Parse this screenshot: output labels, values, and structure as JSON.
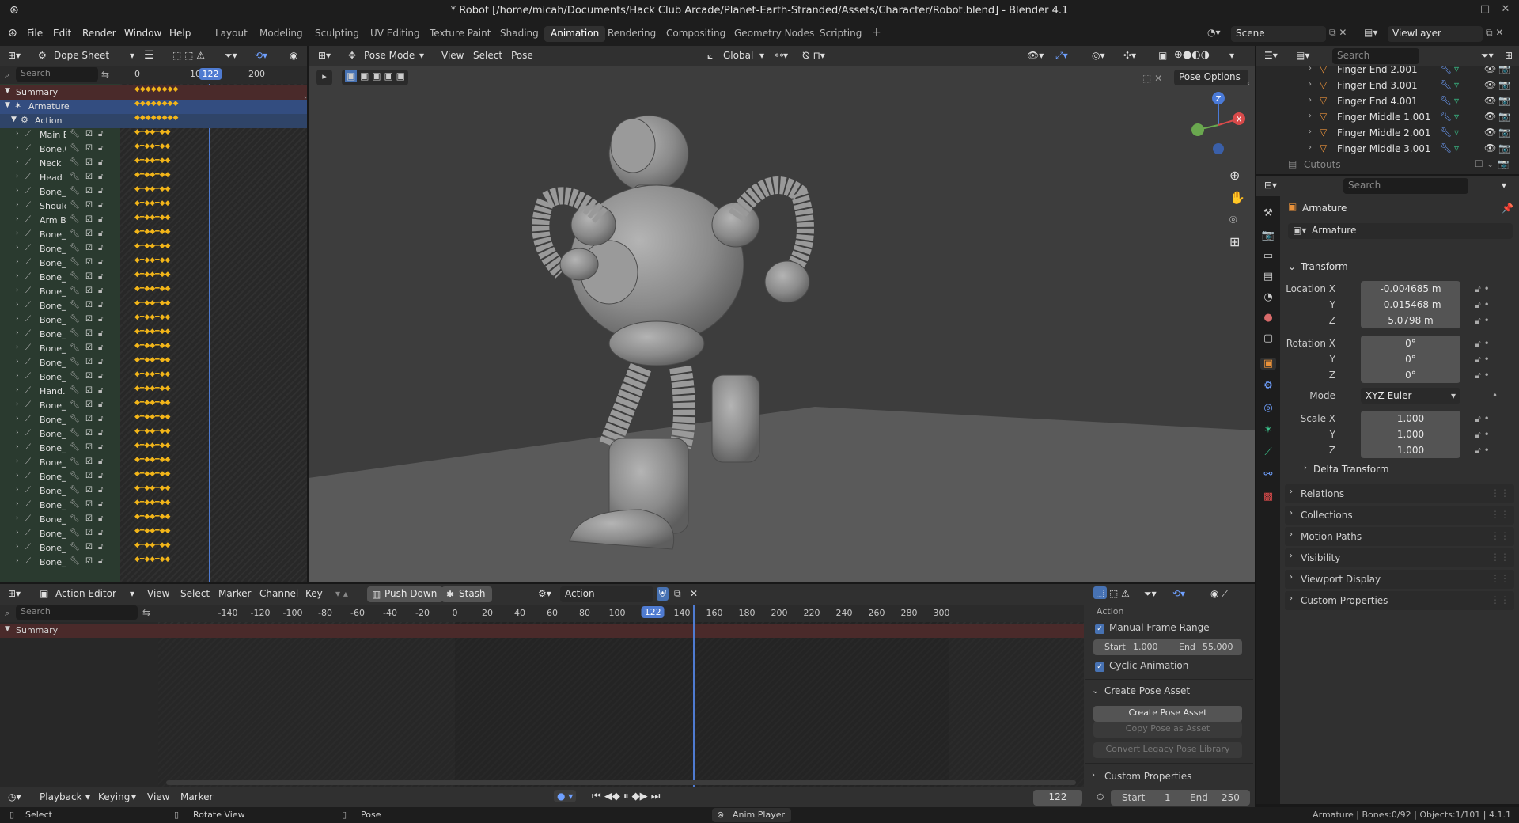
{
  "window": {
    "title": "* Robot [/home/micah/Documents/Hack Club Arcade/Planet-Earth-Stranded/Assets/Character/Robot.blend] - Blender 4.1"
  },
  "menu": [
    "File",
    "Edit",
    "Render",
    "Window",
    "Help"
  ],
  "workspaces": [
    "Layout",
    "Modeling",
    "Sculpting",
    "UV Editing",
    "Texture Paint",
    "Shading",
    "Animation",
    "Rendering",
    "Compositing",
    "Geometry Nodes",
    "Scripting"
  ],
  "active_workspace": "Animation",
  "scene": "Scene",
  "view_layer": "ViewLayer",
  "dopesheet": {
    "mode": "Dope Sheet",
    "search_placeholder": "Search",
    "current_frame": "122",
    "ticks": [
      "0",
      "10",
      "200"
    ],
    "summary": "Summary",
    "armature": "Armature",
    "action": "Action",
    "channels": [
      "Main B",
      "Bone.0",
      "Neck",
      "Head",
      "Bone_l",
      "Should",
      "Arm Ba",
      "Bone_l",
      "Bone_l",
      "Bone_l",
      "Bone_l",
      "Bone_l",
      "Bone_l",
      "Bone_l",
      "Bone_l",
      "Bone_l",
      "Bone_l",
      "Bone_l",
      "Hand.L",
      "Bone_l",
      "Bone_l",
      "Bone_l",
      "Bone_l",
      "Bone_l",
      "Bone_l",
      "Bone_l",
      "Bone_l",
      "Bone_l",
      "Bone_l",
      "Bone_l",
      "Bone_F"
    ]
  },
  "viewport": {
    "mode": "Pose Mode",
    "menus": [
      "View",
      "Select",
      "Pose"
    ],
    "transform_orientation": "Global",
    "pose_options": "Pose Options",
    "gizmo": {
      "z": "Z",
      "x": "X"
    }
  },
  "outliner": {
    "search_placeholder": "Search",
    "items": [
      "Finger End 2.001",
      "Finger End 3.001",
      "Finger End 4.001",
      "Finger Middle 1.001",
      "Finger Middle 2.001",
      "Finger Middle 3.001"
    ],
    "collection": "Cutouts"
  },
  "properties": {
    "search_placeholder": "Search",
    "object_name": "Armature",
    "datablock": "Armature",
    "transform_label": "Transform",
    "location_label": "Location X",
    "location": [
      "-0.004685 m",
      "-0.015468 m",
      "5.0798 m"
    ],
    "rotation_label": "Rotation X",
    "rotation": [
      "0°",
      "0°",
      "0°"
    ],
    "mode_label": "Mode",
    "mode": "XYZ Euler",
    "scale_label": "Scale X",
    "scale": [
      "1.000",
      "1.000",
      "1.000"
    ],
    "axis_y": "Y",
    "axis_z": "Z",
    "sections": [
      "Delta Transform",
      "Relations",
      "Collections",
      "Motion Paths",
      "Visibility",
      "Viewport Display",
      "Custom Properties"
    ]
  },
  "action_editor": {
    "mode": "Action Editor",
    "menus": [
      "View",
      "Select",
      "Marker",
      "Channel",
      "Key"
    ],
    "push_down": "Push Down",
    "stash": "Stash",
    "action_name": "Action",
    "search_placeholder": "Search",
    "summary": "Summary",
    "ticks": [
      "-140",
      "-120",
      "-100",
      "-80",
      "-60",
      "-40",
      "-20",
      "0",
      "20",
      "40",
      "60",
      "80",
      "100",
      "122",
      "140",
      "160",
      "180",
      "200",
      "220",
      "240",
      "260",
      "280",
      "300"
    ],
    "sidebar": {
      "header": "Action",
      "manual_frame_range": "Manual Frame Range",
      "start_label": "Start",
      "start": "1.000",
      "end_label": "End",
      "end": "55.000",
      "cyclic": "Cyclic Animation",
      "create_pose_asset_header": "Create Pose Asset",
      "create_pose_asset": "Create Pose Asset",
      "copy_pose_as_asset": "Copy Pose as Asset",
      "convert_legacy": "Convert Legacy Pose Library",
      "custom_properties": "Custom Properties"
    }
  },
  "timeline": {
    "menus": [
      "Playback",
      "Keying",
      "View",
      "Marker"
    ],
    "current_frame": "122",
    "start_label": "Start",
    "start": "1",
    "end_label": "End",
    "end": "250"
  },
  "statusbar": {
    "select": "Select",
    "rotate_view": "Rotate View",
    "pose": "Pose",
    "addon": "Anim Player",
    "stats": "Armature | Bones:0/92 | Objects:1/101 | 4.1.1"
  },
  "colors": {
    "accent": "#4772b3",
    "keyframe": "#f2b519",
    "playhead": "#4f7bd1",
    "selected_row": "#334d80"
  }
}
